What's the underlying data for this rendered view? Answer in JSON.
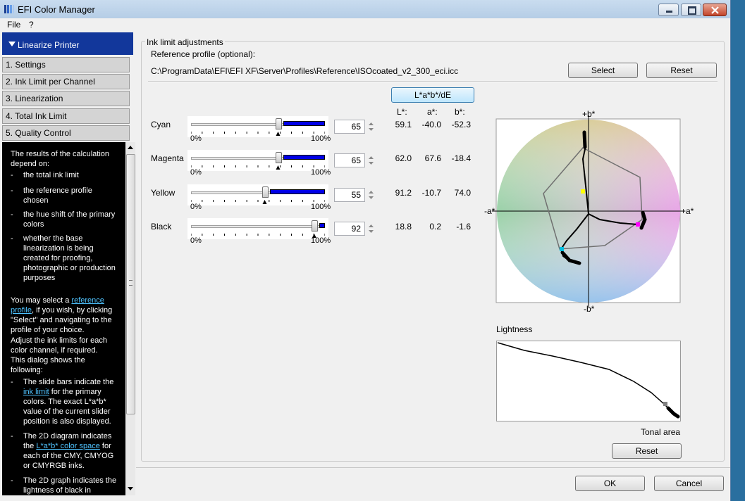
{
  "window": {
    "title": "EFI Color Manager"
  },
  "menu": [
    "File",
    "?"
  ],
  "nav": {
    "header": "Linearize Printer",
    "items": [
      "1. Settings",
      "2. Ink Limit per Channel",
      "3. Linearization",
      "4. Total Ink Limit",
      "5. Quality Control"
    ]
  },
  "help": {
    "intro": "The results of the calculation depend on:",
    "depends": [
      "the total ink limit",
      "the reference profile chosen",
      "the hue shift of the primary colors",
      "whether the base linearization is being created for proofing, photographic or production purposes"
    ],
    "p2_a": "You may select a ",
    "p2_link": "reference profile",
    "p2_b": ", if you wish, by clicking \"Select\" and navigating to the profile of your choice.",
    "p3": "Adjust the ink limits for each color channel, if required.",
    "p4": "This dialog shows the following:",
    "shows": [
      {
        "a": "The slide bars indicate the ",
        "link": "ink limit",
        "b": " for the primary colors. The exact L*a*b* value of the current slider position is also displayed."
      },
      {
        "a": "The 2D diagram indicates the ",
        "link": "L*a*b* color space",
        "b": " for each of the CMY, CMYOG or CMYRGB inks."
      },
      {
        "a": "The 2D graph indicates the lightness of black in",
        "link": "",
        "b": ""
      }
    ]
  },
  "group_title": "Ink limit adjustments",
  "reference": {
    "label": "Reference profile (optional):",
    "path": "C:\\ProgramData\\EFI\\EFI XF\\Server\\Profiles\\Reference\\ISOcoated_v2_300_eci.icc",
    "select": "Select",
    "reset": "Reset"
  },
  "lab_button": "L*a*b*/dE",
  "columns": [
    "L*:",
    "a*:",
    "b*:"
  ],
  "slider_min_label": "0%",
  "slider_max_label": "100%",
  "channels": [
    {
      "name": "Cyan",
      "value": "65",
      "limit": 0.65,
      "L": "59.1",
      "a": "-40.0",
      "b": "-52.3"
    },
    {
      "name": "Magenta",
      "value": "65",
      "limit": 0.65,
      "L": "62.0",
      "a": "67.6",
      "b": "-18.4"
    },
    {
      "name": "Yellow",
      "value": "55",
      "limit": 0.55,
      "L": "91.2",
      "a": "-10.7",
      "b": "74.0"
    },
    {
      "name": "Black",
      "value": "92",
      "limit": 0.92,
      "L": "18.8",
      "a": "0.2",
      "b": "-1.6"
    }
  ],
  "diagram": {
    "plus_b": "+b*",
    "minus_b": "-b*",
    "minus_a": "-a*",
    "plus_a": "+a*"
  },
  "lightness": {
    "label": "Lightness",
    "axis_label": "Tonal area",
    "reset": "Reset"
  },
  "footer": {
    "ok": "OK",
    "cancel": "Cancel"
  }
}
